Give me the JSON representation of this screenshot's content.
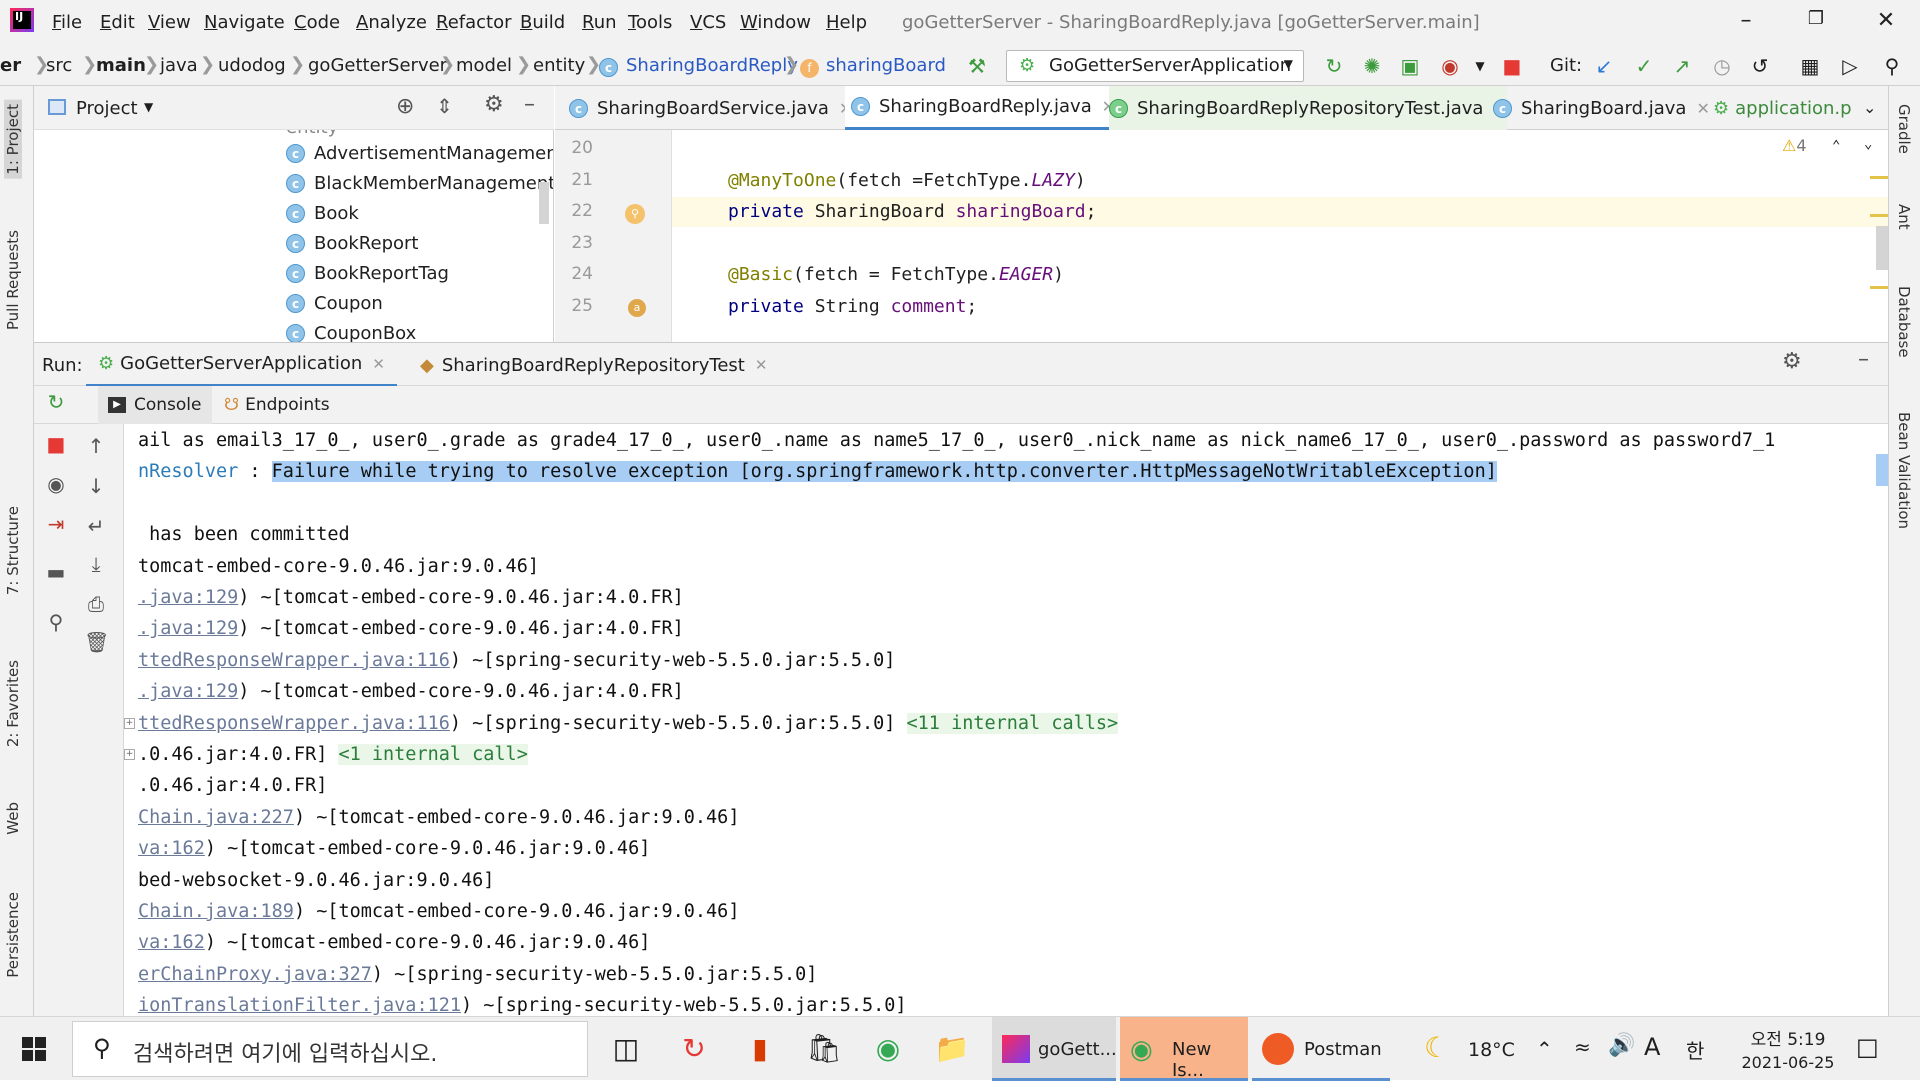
{
  "menu": {
    "items": [
      "File",
      "Edit",
      "View",
      "Navigate",
      "Code",
      "Analyze",
      "Refactor",
      "Build",
      "Run",
      "Tools",
      "VCS",
      "Window",
      "Help"
    ],
    "title": "goGetterServer - SharingBoardReply.java [goGetterServer.main]"
  },
  "breadcrumbs": [
    "er",
    "src",
    "main",
    "java",
    "udodog",
    "goGetterServer",
    "model",
    "entity",
    "SharingBoardReply",
    "sharingBoard"
  ],
  "toolbar": {
    "run_config": "GoGetterServerApplication",
    "git_label": "Git:"
  },
  "left_tabs": [
    "1: Project",
    "Pull Requests",
    "7: Structure",
    "2: Favorites",
    "Web",
    "Persistence"
  ],
  "right_tabs": [
    "Gradle",
    "Ant",
    "Database",
    "Bean Validation"
  ],
  "project": {
    "title": "Project",
    "partial_item": "entity",
    "items": [
      "AdvertisementManagement",
      "BlackMemberManagement",
      "Book",
      "BookReport",
      "BookReportTag",
      "Coupon",
      "CouponBox"
    ]
  },
  "editor": {
    "tabs": [
      "SharingBoardService.java",
      "SharingBoardReply.java",
      "SharingBoardReplyRepositoryTest.java",
      "SharingBoard.java",
      "application.p"
    ],
    "warnings": "4",
    "lines": [
      {
        "no": "20",
        "parts": []
      },
      {
        "no": "21",
        "parts": [
          {
            "c": "ann",
            "t": "@ManyToOne"
          },
          {
            "c": "",
            "t": "(fetch ="
          },
          {
            "c": "",
            "t": "FetchType."
          },
          {
            "c": "it",
            "t": "LAZY"
          },
          {
            "c": "",
            "t": ")"
          }
        ]
      },
      {
        "no": "22",
        "parts": [
          {
            "c": "kw",
            "t": "private "
          },
          {
            "c": "",
            "t": "SharingBoard "
          },
          {
            "c": "fld",
            "t": "sharingBoard"
          },
          {
            "c": "",
            "t": ";"
          }
        ]
      },
      {
        "no": "23",
        "parts": []
      },
      {
        "no": "24",
        "parts": [
          {
            "c": "ann",
            "t": "@Basic"
          },
          {
            "c": "",
            "t": "(fetch = FetchType."
          },
          {
            "c": "it",
            "t": "EAGER"
          },
          {
            "c": "",
            "t": ")"
          }
        ]
      },
      {
        "no": "25",
        "parts": [
          {
            "c": "kw",
            "t": "private "
          },
          {
            "c": "",
            "t": "String "
          },
          {
            "c": "fld",
            "t": "comment"
          },
          {
            "c": "",
            "t": ";"
          }
        ]
      }
    ]
  },
  "run": {
    "label": "Run:",
    "tabs": [
      "GoGetterServerApplication",
      "SharingBoardReplyRepositoryTest"
    ],
    "subtabs": [
      "Console",
      "Endpoints"
    ]
  },
  "console": [
    {
      "segs": [
        {
          "t": "ail as email3_17_0_, user0_.grade as grade4_17_0_, user0_.name as name5_17_0_, user0_.nick_name as nick_name6_17_0_, user0_.password as password7_1",
          "k": ""
        }
      ]
    },
    {
      "segs": [
        {
          "t": "nResolver ",
          "k": "blue"
        },
        {
          "t": ": ",
          "k": ""
        },
        {
          "t": "Failure while trying to resolve exception [org.springframework.http.converter.HttpMessageNotWritableException]",
          "k": "hl"
        }
      ]
    },
    {
      "segs": []
    },
    {
      "segs": [
        {
          "t": " has been committed",
          "k": ""
        }
      ]
    },
    {
      "segs": [
        {
          "t": "tomcat-embed-core-9.0.46.jar:9.0.46]",
          "k": ""
        }
      ]
    },
    {
      "segs": [
        {
          "t": ".java:129",
          "k": "lnk"
        },
        {
          "t": ") ~[tomcat-embed-core-9.0.46.jar:4.0.FR]",
          "k": ""
        }
      ]
    },
    {
      "segs": [
        {
          "t": ".java:129",
          "k": "lnk"
        },
        {
          "t": ") ~[tomcat-embed-core-9.0.46.jar:4.0.FR]",
          "k": ""
        }
      ]
    },
    {
      "segs": [
        {
          "t": "ttedResponseWrapper.java:116",
          "k": "lnk"
        },
        {
          "t": ") ~[spring-security-web-5.5.0.jar:5.5.0]",
          "k": ""
        }
      ]
    },
    {
      "segs": [
        {
          "t": ".java:129",
          "k": "lnk"
        },
        {
          "t": ") ~[tomcat-embed-core-9.0.46.jar:4.0.FR]",
          "k": ""
        }
      ]
    },
    {
      "segs": [
        {
          "t": "ttedResponseWrapper.java:116",
          "k": "lnk"
        },
        {
          "t": ") ~[spring-security-web-5.5.0.jar:5.5.0] ",
          "k": ""
        },
        {
          "t": "<11 internal calls>",
          "k": "gc"
        }
      ]
    },
    {
      "segs": [
        {
          "t": ".0.46.jar:4.0.FR] ",
          "k": ""
        },
        {
          "t": "<1 internal call>",
          "k": "gc"
        }
      ]
    },
    {
      "segs": [
        {
          "t": ".0.46.jar:4.0.FR]",
          "k": ""
        }
      ]
    },
    {
      "segs": [
        {
          "t": "Chain.java:227",
          "k": "lnk"
        },
        {
          "t": ") ~[tomcat-embed-core-9.0.46.jar:9.0.46]",
          "k": ""
        }
      ]
    },
    {
      "segs": [
        {
          "t": "va:162",
          "k": "lnk"
        },
        {
          "t": ") ~[tomcat-embed-core-9.0.46.jar:9.0.46]",
          "k": ""
        }
      ]
    },
    {
      "segs": [
        {
          "t": "bed-websocket-9.0.46.jar:9.0.46]",
          "k": ""
        }
      ]
    },
    {
      "segs": [
        {
          "t": "Chain.java:189",
          "k": "lnk"
        },
        {
          "t": ") ~[tomcat-embed-core-9.0.46.jar:9.0.46]",
          "k": ""
        }
      ]
    },
    {
      "segs": [
        {
          "t": "va:162",
          "k": "lnk"
        },
        {
          "t": ") ~[tomcat-embed-core-9.0.46.jar:9.0.46]",
          "k": ""
        }
      ]
    },
    {
      "segs": [
        {
          "t": "erChainProxy.java:327",
          "k": "lnk"
        },
        {
          "t": ") ~[spring-security-web-5.5.0.jar:5.5.0]",
          "k": ""
        }
      ]
    },
    {
      "segs": [
        {
          "t": "ionTranslationFilter.java:121",
          "k": "lnk"
        },
        {
          "t": ") ~[spring-security-web-5.5.0.jar:5.5.0]",
          "k": ""
        }
      ]
    }
  ],
  "taskbar": {
    "search_placeholder": "검색하려면 여기에 입력하십시오.",
    "apps": [
      "goGett...",
      "New Is...",
      "Postman"
    ],
    "temp": "18°C",
    "ime_a": "A",
    "ime_han": "한",
    "time": "오전 5:19",
    "date": "2021-06-25"
  }
}
